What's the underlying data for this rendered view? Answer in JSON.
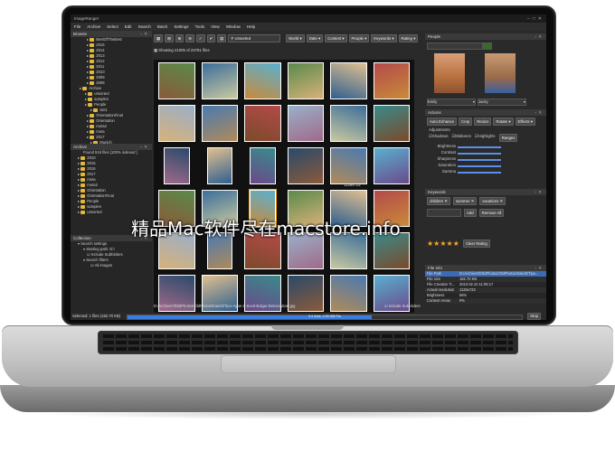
{
  "window": {
    "title": "ImageRanger"
  },
  "menu": [
    "File",
    "Archive",
    "Select",
    "Edit",
    "Search",
    "Batch",
    "Settings",
    "Tools",
    "View",
    "Window",
    "Help"
  ],
  "toolbar": {
    "search_value": "Unsorted",
    "filters": [
      "World",
      "Date",
      "Content",
      "People",
      "Keywords",
      "Rating"
    ]
  },
  "browse": {
    "title": "Browse",
    "items": [
      "BestOfTheBest",
      "2015",
      "2014",
      "2013",
      "2012",
      "2011",
      "2010",
      "2009",
      "2008",
      "Archive",
      "unsorted",
      "samples",
      "People",
      "Set1",
      "OrientationFinal",
      "Orientation",
      "meta2",
      "meta",
      "2017",
      "Munich"
    ]
  },
  "archive": {
    "title": "Archive",
    "found": "Found 516 files [100% indexed ]",
    "items": [
      "2010",
      "2015",
      "2016",
      "2017",
      "meta",
      "meta2",
      "Orientation",
      "OrientationFinal",
      "People",
      "samples",
      "unsorted"
    ]
  },
  "collection": {
    "title": "Collection",
    "items": [
      "Search settings",
      "Starting path: D:\\",
      "Include Subfolders",
      "Search filters",
      "All images"
    ]
  },
  "grid": {
    "showing": "Showing 21005 of 23781 files",
    "overlay": "1126x723",
    "path": "D:/ArchiveOfOldPhotos/OldPhotos/train/0/Tipo-Agan-S-Kevit-Bolgar-Betonovitasi.jpg",
    "include_subfolders": "Include Subfolders"
  },
  "people": {
    "title": "People",
    "name1": "Emily",
    "name2": "Jacky"
  },
  "actions": {
    "title": "Actions",
    "buttons": [
      "Auto Enhance",
      "Crop",
      "Resize",
      "Rotate",
      "Effects"
    ]
  },
  "adjustments": {
    "title": "Adjustments",
    "toggles": [
      "Shadows",
      "Midtones",
      "Highlights",
      "Ranges"
    ],
    "sliders": [
      "Brightness",
      "Contrast",
      "Sharpness",
      "Saturation",
      "Gamma"
    ]
  },
  "keywords": {
    "title": "Keywords",
    "tags": [
      "children",
      "summer",
      "vacations"
    ],
    "add": "Add",
    "remove_all": "Remove All"
  },
  "rating": {
    "value": 5,
    "of": 5,
    "clear": "Clear Rating"
  },
  "fileinfo": {
    "title": "File Info",
    "rows": [
      [
        "File Path",
        "D:/ArchiveOfOldPhotos/OldPhotos/train/0/Tipo..."
      ],
      [
        "File size",
        "182.70 KB"
      ],
      [
        "File Creation Ti...",
        "2010.02.10 11:08:17"
      ],
      [
        "Actual resolution",
        "1126x723"
      ],
      [
        "Brightness",
        "66%"
      ],
      [
        "Content Areas",
        "0%"
      ]
    ]
  },
  "status": {
    "selected": "Selected: 1 files (182.70 KB)",
    "progress_text": "3.4 mins, 4.99 GiB Pro",
    "progress": 0.62,
    "stop": "Stop"
  },
  "watermark": "精品Mac软件尽在macstore.info",
  "colors": {
    "accent": "#3b7ddd",
    "folder": "#e2b83a",
    "star": "#f5a623",
    "bg": "#2a2a2a"
  }
}
